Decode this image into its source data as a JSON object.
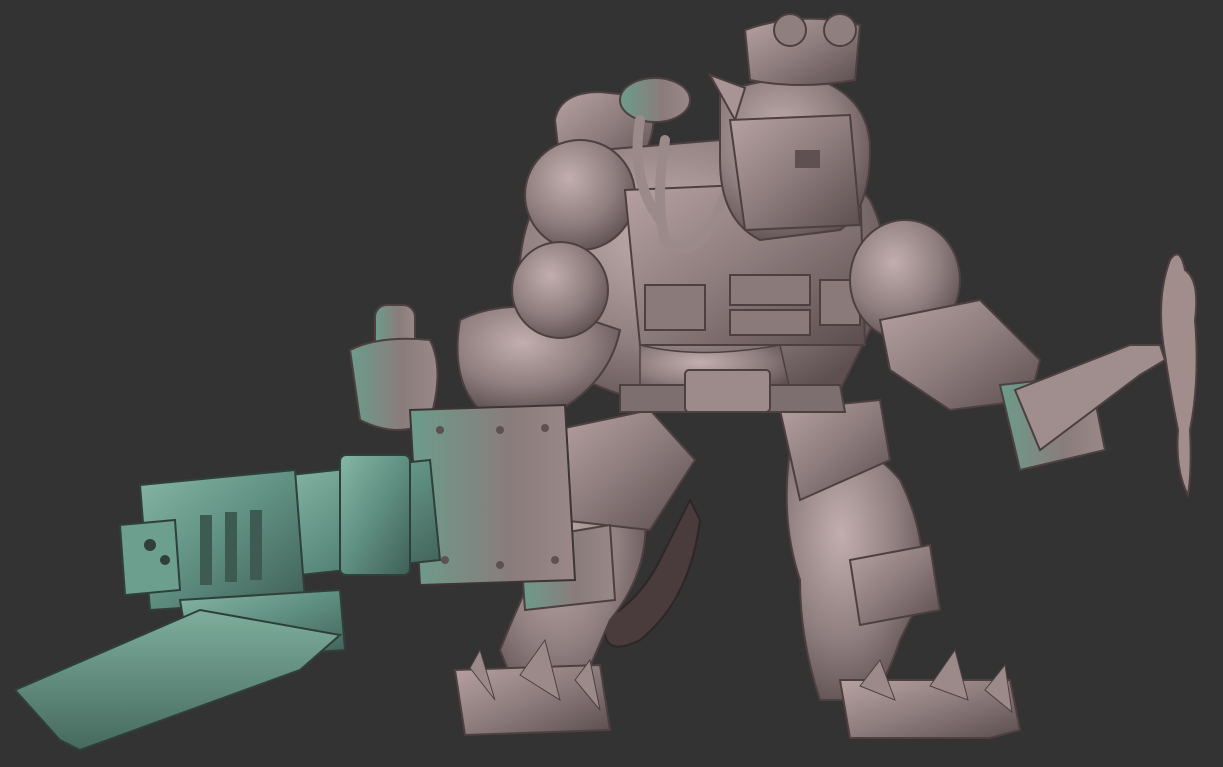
{
  "scene": {
    "subject": "orc-miniature-sculpt",
    "background_color": "#333333",
    "colors": {
      "skin_base": "#8a7a7a",
      "skin_light": "#b39f9f",
      "skin_dark": "#5a4b4c",
      "rim_green": "#5f8f80",
      "green_light": "#7fb09e",
      "metal_base": "#7d7272",
      "shadow": "#3b3435"
    }
  }
}
